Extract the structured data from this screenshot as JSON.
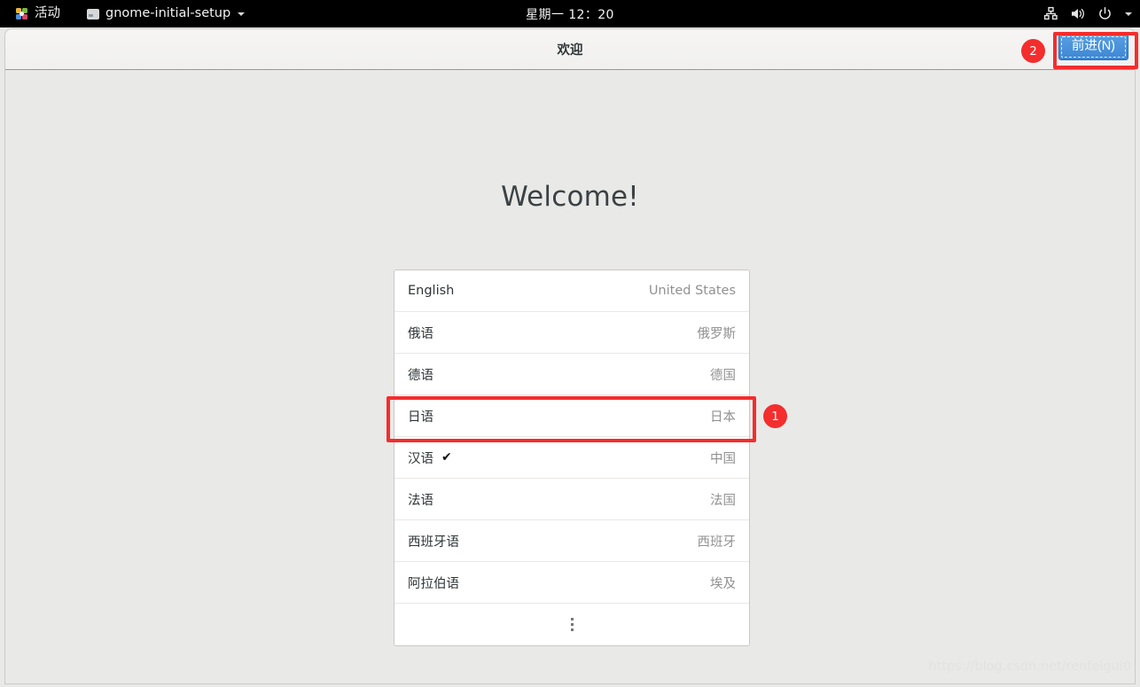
{
  "topbar": {
    "activities_label": "活动",
    "app_name": "gnome-initial-setup",
    "clock": "星期一 12：20",
    "tray_icons": [
      "network-wired-icon",
      "volume-icon",
      "power-icon",
      "chevron-down-icon"
    ]
  },
  "window": {
    "title": "欢迎",
    "next_button_label": "前进(N)",
    "accent_color": "#3c86d4"
  },
  "content": {
    "heading": "Welcome!",
    "more_label": "⋮"
  },
  "languages": [
    {
      "name": "English",
      "country": "United States",
      "selected": false
    },
    {
      "name": "俄语",
      "country": "俄罗斯",
      "selected": false
    },
    {
      "name": "德语",
      "country": "德国",
      "selected": false
    },
    {
      "name": "日语",
      "country": "日本",
      "selected": false
    },
    {
      "name": "汉语",
      "country": "中国",
      "selected": true,
      "check": "✔"
    },
    {
      "name": "法语",
      "country": "法国",
      "selected": false
    },
    {
      "name": "西班牙语",
      "country": "西班牙",
      "selected": false
    },
    {
      "name": "阿拉伯语",
      "country": "埃及",
      "selected": false
    }
  ],
  "annotations": {
    "color": "#f42d2d",
    "badge_1": "1",
    "badge_2": "2"
  },
  "watermark": "https://blog.csdn.net/renfeigui0"
}
